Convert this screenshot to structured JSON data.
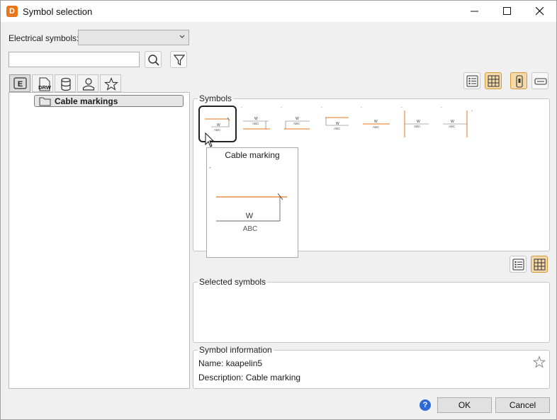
{
  "window": {
    "app_icon_letter": "D",
    "title": "Symbol selection"
  },
  "filter": {
    "label": "Electrical symbols:",
    "selected_value": "",
    "search_value": "",
    "search_placeholder": ""
  },
  "tabs": [
    {
      "icon": "electrical-e-icon",
      "label": "E",
      "active": true
    },
    {
      "icon": "drw-file-icon",
      "label": "DRW",
      "active": false
    },
    {
      "icon": "database-icon",
      "active": false
    },
    {
      "icon": "user-icon",
      "active": false
    },
    {
      "icon": "star-icon",
      "active": false
    }
  ],
  "tree": {
    "items": [
      {
        "label": "Cable markings",
        "icon": "folder-icon",
        "selected": true
      }
    ]
  },
  "symbols": {
    "legend": "Symbols",
    "selected_index": 0,
    "accent_line": "#e8761a",
    "preview": {
      "title": "Cable marking",
      "top_label": "W",
      "bottom_label": "ABC"
    }
  },
  "selected_symbols": {
    "legend": "Selected symbols"
  },
  "symbol_information": {
    "legend": "Symbol information",
    "name_label": "Name:",
    "name_value": "kaapelin5",
    "description_label": "Description:",
    "description_value": "Cable marking"
  },
  "view_modes": {
    "top_list_active": false,
    "top_grid_active": true,
    "portrait_active": true,
    "landscape_active": false,
    "bottom_list_active": false,
    "bottom_grid_active": true,
    "active_color": "#f6d9a8"
  },
  "buttons": {
    "ok": "OK",
    "cancel": "Cancel",
    "help": "?"
  }
}
